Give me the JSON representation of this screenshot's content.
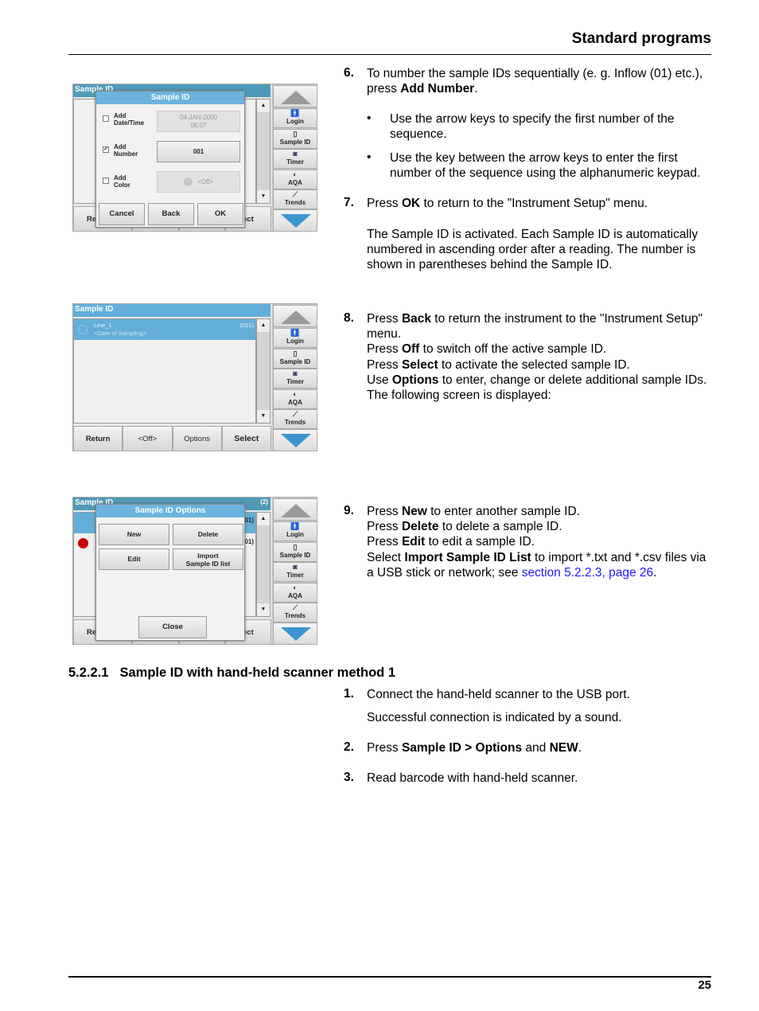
{
  "header": {
    "title": "Standard programs"
  },
  "device_sidebar": {
    "items": [
      {
        "label": "Login",
        "icon": "login-icon",
        "glyph": "🚹"
      },
      {
        "label": "Sample ID",
        "icon": "sample-id-icon",
        "glyph": "▯"
      },
      {
        "label": "Timer",
        "icon": "timer-icon",
        "glyph": "◙"
      },
      {
        "label": "AQA",
        "icon": "aqa-icon",
        "glyph": "◐"
      },
      {
        "label": "Trends",
        "icon": "trends-icon",
        "glyph": "⟋"
      }
    ]
  },
  "screen1": {
    "bg_title": "Sample ID",
    "bg_left": "Re",
    "bg_right": "ect",
    "dialog_title": "Sample ID",
    "rows": [
      {
        "label1": "Add",
        "label2": "Date/Time",
        "checked": false,
        "value1": "04-JAN-2000",
        "value2": "06:07"
      },
      {
        "label1": "Add",
        "label2": "Number",
        "checked": true,
        "value1": "001"
      },
      {
        "label1": "Add",
        "label2": "Color",
        "checked": false,
        "value1": "<Off>"
      }
    ],
    "buttons": [
      "Cancel",
      "Back",
      "OK"
    ]
  },
  "screen2": {
    "title": "Sample ID",
    "item_name": "Line_1",
    "item_sub": "<Date of Sampling>",
    "item_count": "(001)",
    "buttons": [
      "Return",
      "<Off>",
      "Options",
      "Select"
    ]
  },
  "screen3": {
    "bg_title": "Sample ID",
    "bg_count": "(2)",
    "bg_left": "Re",
    "bg_right": "ect",
    "bg_num1": "01)",
    "bg_num2": "01)",
    "dialog_title": "Sample ID Options",
    "buttons": {
      "new": "New",
      "delete": "Delete",
      "edit": "Edit",
      "import1": "Import",
      "import2": "Sample ID list",
      "close": "Close"
    }
  },
  "steps": {
    "s6": {
      "num": "6.",
      "t1": "To number the sample IDs sequentially (e. g. Inflow (01) etc.), press ",
      "b1": "Add Number",
      "t2": ".",
      "bullets": [
        "Use the arrow keys to specify the first number of the sequence.",
        "Use the key between the arrow keys to enter the first number of the sequence using the alphanumeric keypad."
      ],
      "bullet": "•"
    },
    "s7": {
      "num": "7.",
      "t1": "Press ",
      "b1": "OK",
      "t2": " to return to the \"Instrument Setup\" menu.",
      "para": "The Sample ID is activated. Each Sample ID is automatically numbered in ascending order after a reading. The number is shown in parentheses behind the Sample ID."
    },
    "s8": {
      "num": "8.",
      "lines": [
        {
          "a": "Press ",
          "b": "Back",
          "c": " to return the instrument to the \"Instrument Setup\" menu."
        },
        {
          "a": "Press ",
          "b": "Off",
          "c": " to switch off the active sample ID."
        },
        {
          "a": "Press ",
          "b": "Select",
          "c": " to activate the selected sample ID."
        },
        {
          "a": "Use ",
          "b": "Options",
          "c": " to enter, change or delete additional sample IDs. The following screen is displayed:"
        }
      ]
    },
    "s9": {
      "num": "9.",
      "lines": [
        {
          "a": "Press ",
          "b": "New",
          "c": " to enter another sample ID."
        },
        {
          "a": "Press ",
          "b": "Delete",
          "c": " to delete a sample ID."
        },
        {
          "a": "Press ",
          "b": "Edit",
          "c": " to edit a sample ID."
        },
        {
          "a": "Select ",
          "b": "Import Sample ID List",
          "c": " to import *.txt and *.csv files via a USB stick or network; see "
        }
      ],
      "link": "section 5.2.2.3, page 26",
      "end": "."
    }
  },
  "section": {
    "number": "5.2.2.1",
    "title": "Sample ID with hand-held scanner method 1",
    "steps": [
      {
        "num": "1.",
        "text": "Connect the hand-held scanner to the USB port.",
        "para": "Successful connection is indicated by a sound."
      },
      {
        "num": "2.",
        "a": "Press ",
        "b": "Sample ID > Options",
        "c": " and ",
        "d": "NEW",
        "e": "."
      },
      {
        "num": "3.",
        "text": "Read barcode with hand-held scanner."
      }
    ]
  },
  "footer": {
    "page": "25"
  },
  "colors": {
    "title_bar": "#6bb3de",
    "link": "#1a1aff",
    "down_arrow": "#3d95cf"
  }
}
